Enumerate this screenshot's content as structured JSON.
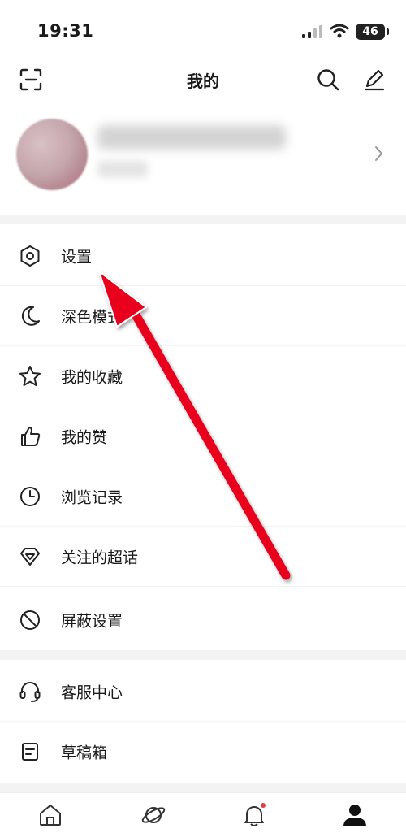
{
  "status_bar": {
    "time": "19:31",
    "battery": "46"
  },
  "header": {
    "title": "我的"
  },
  "menu_group1": [
    {
      "label": "设置",
      "icon": "hexagon-settings-icon"
    },
    {
      "label": "深色模式",
      "icon": "moon-icon"
    },
    {
      "label": "我的收藏",
      "icon": "star-icon"
    },
    {
      "label": "我的赞",
      "icon": "thumbs-up-icon"
    },
    {
      "label": "浏览记录",
      "icon": "clock-icon"
    },
    {
      "label": "关注的超话",
      "icon": "diamond-icon"
    },
    {
      "label": "屏蔽设置",
      "icon": "block-icon"
    }
  ],
  "menu_group2": [
    {
      "label": "客服中心",
      "icon": "headset-icon"
    },
    {
      "label": "草稿箱",
      "icon": "draft-icon"
    }
  ],
  "bottom_nav": [
    {
      "icon": "home-icon"
    },
    {
      "icon": "planet-icon"
    },
    {
      "icon": "bell-icon"
    },
    {
      "icon": "profile-icon"
    }
  ],
  "colors": {
    "accent_red": "#e8001a",
    "divider": "#f3f3f3",
    "text": "#1a1a1a"
  }
}
